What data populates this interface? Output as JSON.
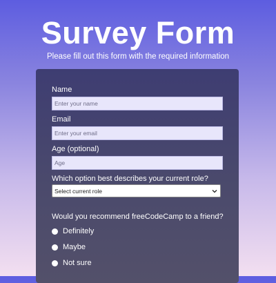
{
  "header": {
    "title": "Survey Form",
    "subtitle": "Please fill out this form with the required information"
  },
  "form": {
    "name": {
      "label": "Name",
      "placeholder": "Enter your name",
      "value": ""
    },
    "email": {
      "label": "Email",
      "placeholder": "Enter your email",
      "value": ""
    },
    "age": {
      "label": "Age (optional)",
      "placeholder": "Age",
      "value": ""
    },
    "role": {
      "label": "Which option best describes your current role?",
      "selected": "Select current role"
    },
    "recommend": {
      "question": "Would you recommend freeCodeCamp to a friend?",
      "options": [
        "Definitely",
        "Maybe",
        "Not sure"
      ]
    }
  },
  "colors": {
    "card": "#4b4a6c",
    "input_bg": "#e8e6fb",
    "text": "#ffffff"
  }
}
